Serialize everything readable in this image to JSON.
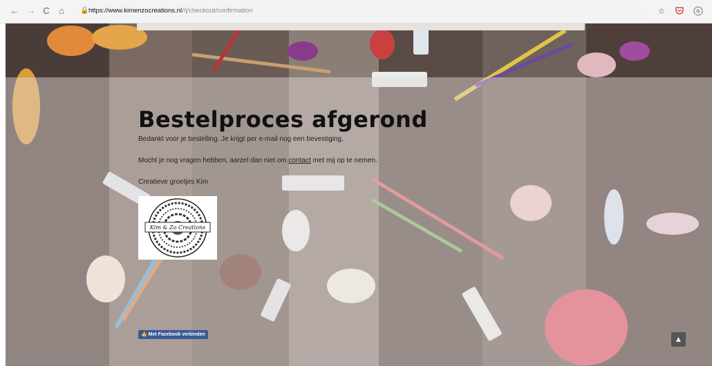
{
  "browser": {
    "url_domain": "https://www.kimenzocreations.nl",
    "url_path": "//j/checkout/confirmation",
    "back_icon": "←",
    "forward_icon": "→",
    "reload_icon": "C",
    "home_icon": "⌂",
    "star_icon": "☆"
  },
  "page": {
    "title": "Bestelproces afgerond",
    "thanks": "Bedankt voor je bestelling. Je krijgt per e-mail nog een bevestiging.",
    "questions_before": "Mocht je nog vragen hebben, aarzel dan niet om",
    "contact_link": "contact",
    "questions_after": "met mij op te nemen.",
    "signoff": "Creatieve groetjes Kim",
    "logo_text": "Kim & Zo Creations"
  },
  "footer": {
    "facebook_label": "Met Facebook verbinden",
    "to_top_icon": "▲"
  }
}
